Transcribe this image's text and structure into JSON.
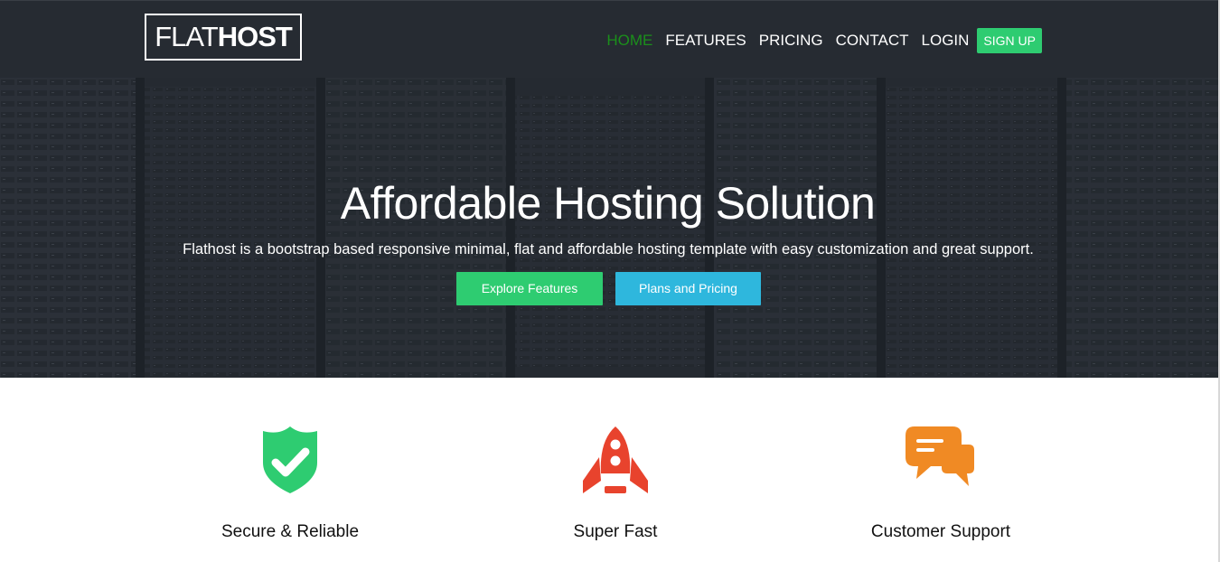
{
  "brand": {
    "light": "FLAT",
    "bold": "HOST"
  },
  "nav": {
    "items": [
      {
        "label": "HOME",
        "active": true
      },
      {
        "label": "FEATURES"
      },
      {
        "label": "PRICING"
      },
      {
        "label": "CONTACT"
      },
      {
        "label": "LOGIN"
      }
    ],
    "signup": "SIGN UP"
  },
  "hero": {
    "title": "Affordable Hosting Solution",
    "subtitle": "Flathost is a bootstrap based responsive minimal, flat and affordable hosting template with easy customization and great support.",
    "primary_button": "Explore Features",
    "secondary_button": "Plans and Pricing"
  },
  "features": [
    {
      "label": "Secure & Reliable",
      "icon": "shield-check-icon",
      "color": "#2ecc71"
    },
    {
      "label": "Super Fast",
      "icon": "rocket-icon",
      "color": "#e8432d"
    },
    {
      "label": "Customer Support",
      "icon": "chat-bubbles-icon",
      "color": "#f08a24"
    }
  ],
  "colors": {
    "navbar": "#262b32",
    "accent_green": "#2ecc71",
    "accent_blue": "#2eb7dd",
    "active_nav": "#1b8f1b"
  }
}
